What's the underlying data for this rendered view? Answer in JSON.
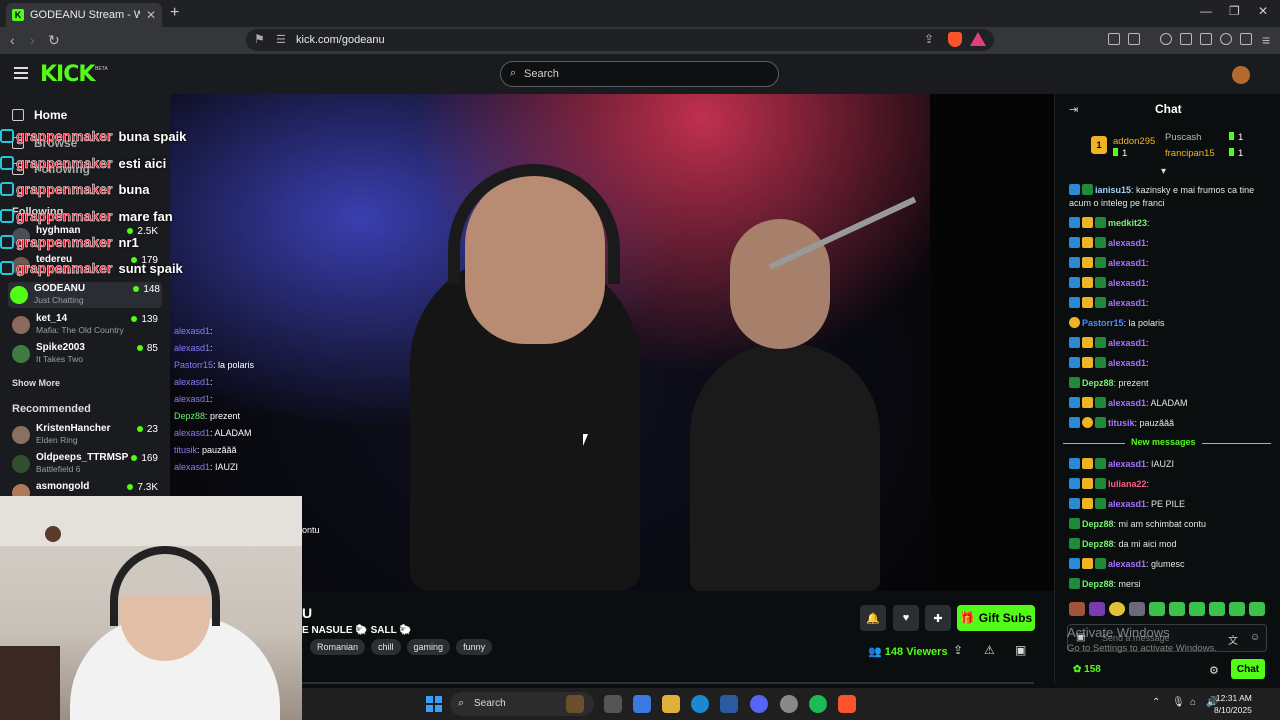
{
  "browser": {
    "tab_title": "GODEANU Stream - Watch Li",
    "url": "kick.com/godeanu"
  },
  "header": {
    "logo": "KICK",
    "beta": "BETA",
    "search_placeholder": "Search"
  },
  "sidebar": {
    "home": "Home",
    "browse": "Browse",
    "following": "Following",
    "following_section": "Following",
    "channels": [
      {
        "name": "hyghman",
        "game": "",
        "viewers": "2.5K",
        "avatar_color": "#4a4e57"
      },
      {
        "name": "tedereu",
        "game": "GTA Mobile",
        "viewers": "179",
        "avatar_color": "#6a5a50"
      },
      {
        "name": "GODEANU",
        "game": "Just Chatting",
        "viewers": "148",
        "avatar_color": "#53fc18"
      },
      {
        "name": "ket_14",
        "game": "Mafia: The Old Country",
        "viewers": "139",
        "avatar_color": "#8a6a5a"
      },
      {
        "name": "Spike2003",
        "game": "It Takes Two",
        "viewers": "85",
        "avatar_color": "#3f7a3f"
      }
    ],
    "show_more": "Show More",
    "recommended_section": "Recommended",
    "recommended": [
      {
        "name": "KristenHancher",
        "game": "Elden Ring",
        "viewers": "23",
        "avatar_color": "#8a7060"
      },
      {
        "name": "Oldpeeps_TTRMSP",
        "game": "Battlefield 6",
        "viewers": "169",
        "avatar_color": "#2f4f2f"
      },
      {
        "name": "asmongold",
        "game": "",
        "viewers": "7.3K",
        "avatar_color": "#b07a5a"
      }
    ]
  },
  "overlay_chat": [
    {
      "user": "grappenmaker",
      "text": "buna spaik"
    },
    {
      "user": "grappenmaker",
      "text": "esti aici"
    },
    {
      "user": "grappenmaker",
      "text": "buna"
    },
    {
      "user": "grappenmaker",
      "text": "mare fan"
    },
    {
      "user": "grappenmaker",
      "text": "nr1"
    },
    {
      "user": "grappenmaker",
      "text": "sunt spaik"
    }
  ],
  "ingame_chat": [
    {
      "user": "alexasd1",
      "text": ":"
    },
    {
      "user": "alexasd1",
      "text": ":"
    },
    {
      "user": "Pastorr15",
      "text": ": la polaris"
    },
    {
      "user": "alexasd1",
      "text": ":"
    },
    {
      "user": "alexasd1",
      "text": ":"
    },
    {
      "user": "Depz88",
      "text": ": prezent"
    },
    {
      "user": "alexasd1",
      "text": ": ALADAM"
    },
    {
      "user": "titusik",
      "text": ": pauzăăă"
    },
    {
      "user": "alexasd1",
      "text": ": IAUZI"
    }
  ],
  "overlay_fragment": "ontu",
  "stream": {
    "name": "U",
    "title": "E NASULE 🐑 SALL 🐑",
    "tags": [
      "Romanian",
      "chill",
      "gaming",
      "funny"
    ],
    "gift_label": "Gift Subs",
    "viewers": "148",
    "viewers_label": "Viewers"
  },
  "chat": {
    "title": "Chat",
    "leaderboard": [
      {
        "rank": "1",
        "name": "addon295",
        "count": "1"
      },
      {
        "name": "Puscash",
        "count": "1"
      },
      {
        "name": "francipan15",
        "count": "1"
      }
    ],
    "messages": [
      {
        "user": "ianisu15",
        "text": ": kazinsky e mai frumos ca tine acum o inteleg pe franci",
        "color": "c"
      },
      {
        "user": "medkit23",
        "text": ":",
        "color": "g"
      },
      {
        "user": "alexasd1",
        "text": ":",
        "color": "p"
      },
      {
        "user": "alexasd1",
        "text": ":",
        "color": "p"
      },
      {
        "user": "alexasd1",
        "text": ":",
        "color": "p"
      },
      {
        "user": "alexasd1",
        "text": ":",
        "color": "p"
      },
      {
        "user": "Pastorr15",
        "text": ": la polaris",
        "color": "bl"
      },
      {
        "user": "alexasd1",
        "text": ":",
        "color": "p"
      },
      {
        "user": "alexasd1",
        "text": ":",
        "color": "p"
      },
      {
        "user": "Depz88",
        "text": ": prezent",
        "color": "g"
      },
      {
        "user": "alexasd1",
        "text": ": ALADAM",
        "color": "p"
      },
      {
        "user": "titusik",
        "text": ": pauzăăă",
        "color": "p"
      }
    ],
    "new_messages_label": "New messages",
    "new_messages": [
      {
        "user": "alexasd1",
        "text": ": IAUZI",
        "color": "p"
      },
      {
        "user": "luliana22",
        "text": ":",
        "color": "r"
      },
      {
        "user": "alexasd1",
        "text": ": PE PILE",
        "color": "p"
      },
      {
        "user": "Depz88",
        "text": ": mi am schimbat contu",
        "color": "g"
      },
      {
        "user": "Depz88",
        "text": ": da mi aici mod",
        "color": "g"
      },
      {
        "user": "alexasd1",
        "text": ": glumesc",
        "color": "p"
      },
      {
        "user": "Depz88",
        "text": ": mersi",
        "color": "g"
      }
    ],
    "input_placeholder": "Send a message",
    "points": "158",
    "send_label": "Chat"
  },
  "watermark": {
    "line1": "Activate Windows",
    "line2": "Go to Settings to activate Windows."
  },
  "taskbar": {
    "search": "Search",
    "time": "12:31 AM",
    "date": "8/10/2025"
  }
}
